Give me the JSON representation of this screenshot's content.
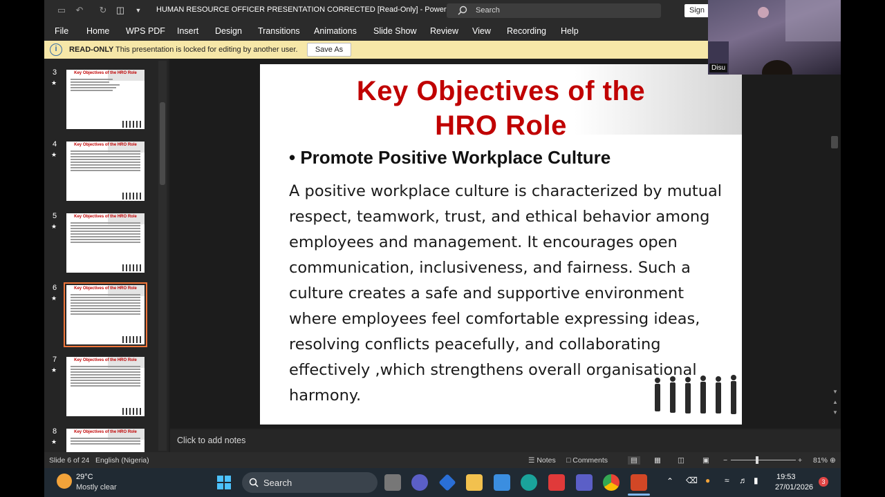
{
  "window": {
    "title": "HUMAN RESOURCE OFFICER PRESENTATION CORRECTED [Read-Only]  -  PowerPoint",
    "search_placeholder": "Search",
    "sign_in": "Sign"
  },
  "menu": [
    "File",
    "Home",
    "WPS PDF",
    "Insert",
    "Design",
    "Transitions",
    "Animations",
    "Slide Show",
    "Review",
    "View",
    "Recording",
    "Help"
  ],
  "infobar": {
    "label": "READ-ONLY",
    "message": "This presentation is locked for editing by another user.",
    "button": "Save As"
  },
  "thumbnails": [
    {
      "number": "3",
      "title": "Key Objectives of the HRO Role",
      "selected": false
    },
    {
      "number": "4",
      "title": "Key Objectives of the HRO Role",
      "selected": false
    },
    {
      "number": "5",
      "title": "Key Objectives of the HRO Role",
      "selected": false
    },
    {
      "number": "6",
      "title": "Key Objectives of the HRO Role",
      "selected": true
    },
    {
      "number": "7",
      "title": "Key Objectives of the HRO Role",
      "selected": false
    },
    {
      "number": "8",
      "title": "Key Objectives of the HRO Role",
      "selected": false
    }
  ],
  "slide": {
    "title_line1": "Key Objectives of the",
    "title_line2": "HRO Role",
    "bullet": "Promote Positive Workplace Culture",
    "body": "A positive workplace culture is characterized by mutual respect, teamwork, trust, and ethical behavior among employees and management. It encourages open communication, inclusiveness, and fairness. Such a culture creates a safe and supportive environment where employees feel comfortable expressing ideas, resolving conflicts peacefully, and collaborating effectively ,which strengthens overall organisational harmony."
  },
  "notes_placeholder": "Click to add notes",
  "status": {
    "slide": "Slide 6 of 24",
    "language": "English (Nigeria)",
    "notes": "Notes",
    "comments": "Comments",
    "zoom": "81%"
  },
  "webcam": {
    "name": "Disu"
  },
  "taskbar": {
    "temperature": "29°C",
    "weather": "Mostly clear",
    "search": "Search",
    "time": "19:53",
    "date": "27/01/2026",
    "notifications": "3"
  },
  "colors": {
    "accent": "#c00000",
    "selection": "#f0763b",
    "infobar": "#f6e7a8"
  }
}
